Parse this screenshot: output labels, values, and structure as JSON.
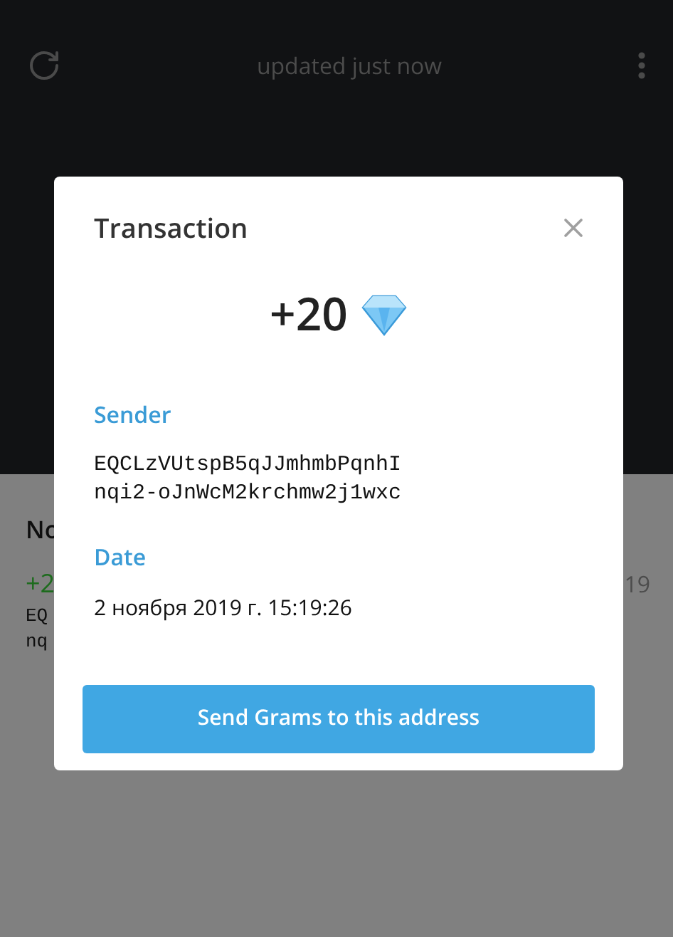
{
  "header": {
    "status": "updated just now"
  },
  "background_list": {
    "heading": "No",
    "amount": "+2",
    "time": "19",
    "address_lines": [
      "EQ",
      "nq"
    ]
  },
  "dialog": {
    "title": "Transaction",
    "amount": "+20",
    "fields": [
      {
        "label": "Sender",
        "kind": "address",
        "lines": [
          "EQCLzVUtspB5qJJmhmbPqnhI",
          "nqi2-oJnWcM2krchmw2j1wxc"
        ]
      },
      {
        "label": "Date",
        "kind": "text",
        "lines": [
          "2 ноября 2019 г. 15:19:26"
        ]
      }
    ],
    "button": "Send Grams to this address"
  }
}
